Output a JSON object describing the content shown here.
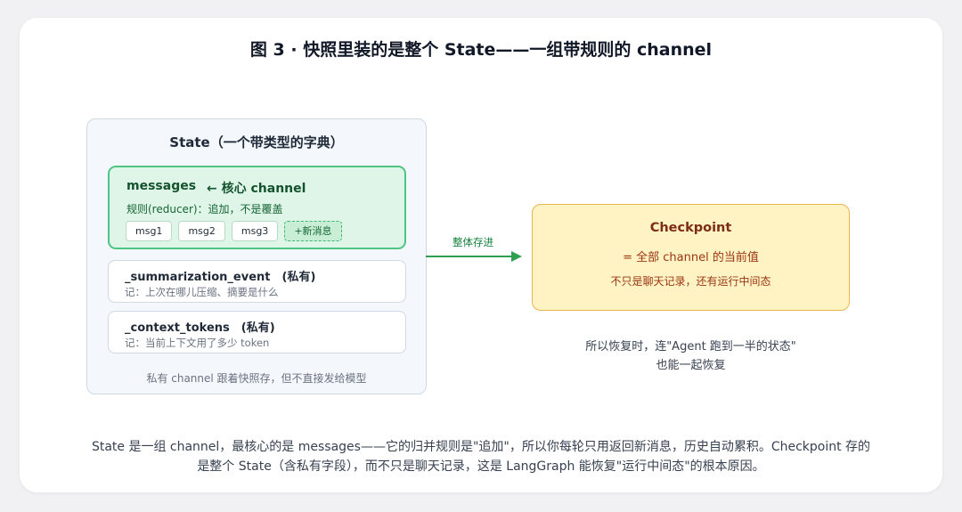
{
  "figure": {
    "title": "图 3 · 快照里装的是整个 State——一组带规则的 channel"
  },
  "state": {
    "title": "State（一个带类型的字典）",
    "messages": {
      "name": "messages",
      "core_label": "← 核心 channel",
      "rule": "规则(reducer)：追加，不是覆盖",
      "chips": [
        "msg1",
        "msg2",
        "msg3"
      ],
      "new_chip": "+新消息"
    },
    "summarization": {
      "name": "_summarization_event　(私有)",
      "note": "记：上次在哪儿压缩、摘要是什么"
    },
    "context_tokens": {
      "name": "_context_tokens　(私有)",
      "note": "记：当前上下文用了多少 token"
    },
    "footer": "私有 channel 跟着快照存，但不直接发给模型"
  },
  "arrow": {
    "label": "整体存进"
  },
  "checkpoint": {
    "title": "Checkpoint",
    "line1": "= 全部 channel 的当前值",
    "line2": "不只是聊天记录，还有运行中间态"
  },
  "restore_note": {
    "line1": "所以恢复时，连\"Agent 跑到一半的状态\"",
    "line2": "也能一起恢复"
  },
  "caption": {
    "line1": "State 是一组 channel，最核心的是 messages——它的归并规则是\"追加\"，所以你每轮只用返回新消息，历史自动累积。Checkpoint 存的",
    "line2": "是整个 State（含私有字段），而不只是聊天记录，这是 LangGraph 能恢复\"运行中间态\"的根本原因。"
  },
  "colors": {
    "messages_fill": "#dff5e8",
    "messages_border": "#4fc583",
    "checkpoint_fill": "#fff3c4",
    "checkpoint_border": "#eab54d",
    "arrow": "#2e9e4f"
  }
}
